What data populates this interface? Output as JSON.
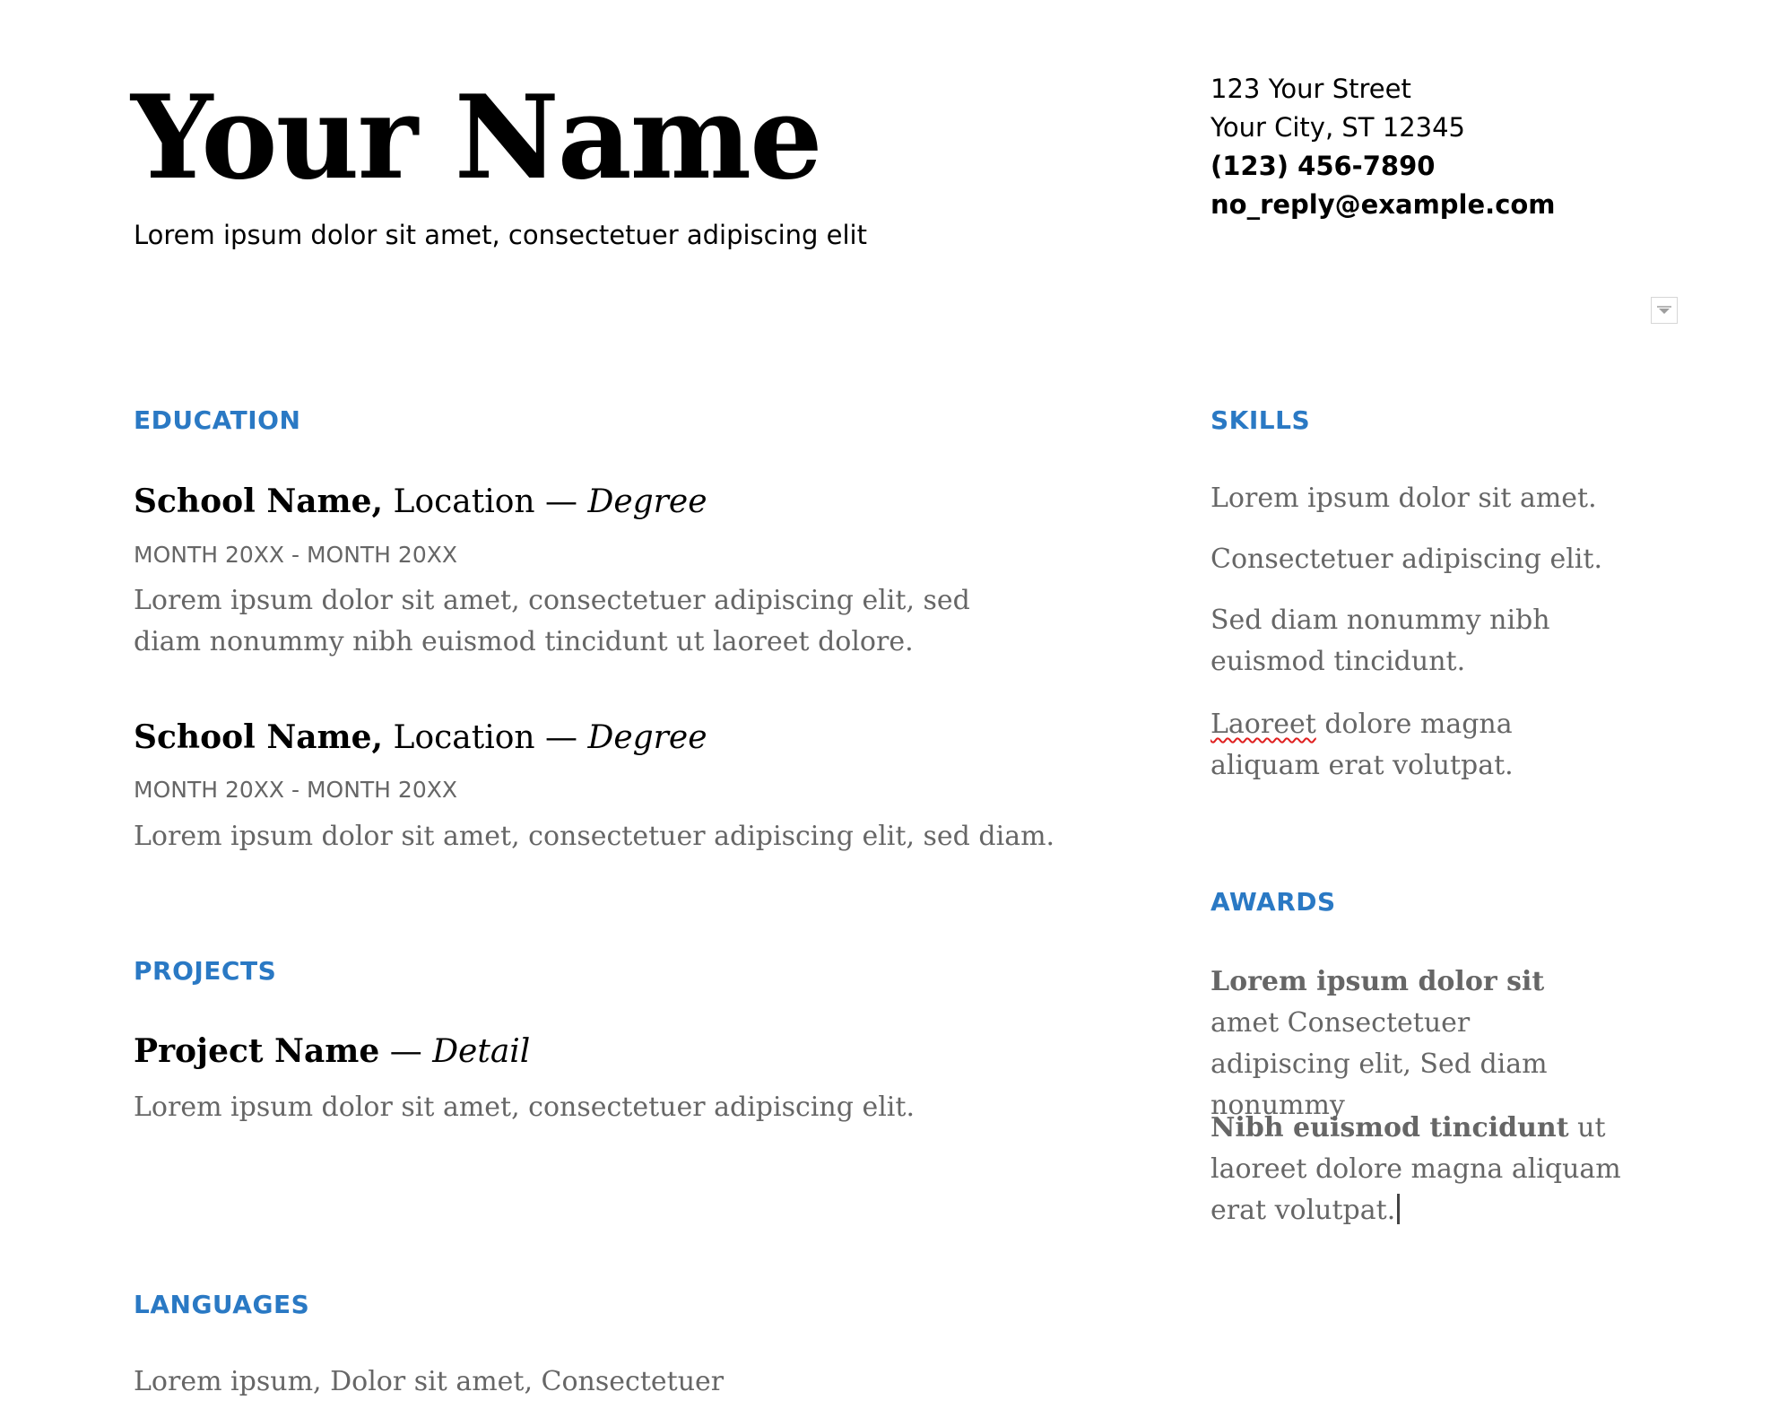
{
  "header": {
    "name": "Your Name",
    "tagline": "Lorem ipsum dolor sit amet, consectetuer adipiscing elit"
  },
  "contact": {
    "street": "123 Your Street",
    "city": "Your City, ST 12345",
    "phone": "(123) 456-7890",
    "email": "no_reply@example.com"
  },
  "colors": {
    "heading": "#2a79c4",
    "body_text": "#666666",
    "spellcheck": "#e02020"
  },
  "education": {
    "heading": "EDUCATION",
    "entries": [
      {
        "school": "School Name,",
        "location": " Location — ",
        "degree": "Degree",
        "dates": "MONTH 20XX - MONTH 20XX",
        "description": "Lorem ipsum dolor sit amet, consectetuer adipiscing elit, sed diam nonummy nibh euismod tincidunt ut laoreet dolore."
      },
      {
        "school": "School Name,",
        "location": " Location — ",
        "degree": "Degree",
        "dates": "MONTH 20XX - MONTH 20XX",
        "description": "Lorem ipsum dolor sit amet, consectetuer adipiscing elit, sed diam."
      }
    ]
  },
  "projects": {
    "heading": "PROJECTS",
    "entries": [
      {
        "name": "Project Name",
        "separator": " — ",
        "detail": "Detail",
        "description": "Lorem ipsum dolor sit amet, consectetuer adipiscing elit."
      }
    ]
  },
  "languages": {
    "heading": "LANGUAGES",
    "text": "Lorem ipsum, Dolor sit amet, Consectetuer"
  },
  "skills": {
    "heading": "SKILLS",
    "items": [
      "Lorem ipsum dolor sit amet.",
      "Consectetuer adipiscing elit.",
      "Sed diam nonummy nibh euismod tincidunt."
    ],
    "last_item_misspelled_word": "Laoreet",
    "last_item_rest": " dolore magna aliquam erat volutpat."
  },
  "awards": {
    "heading": "AWARDS",
    "items": [
      {
        "bold": "Lorem ipsum dolor sit",
        "rest": " amet Consectetuer adipiscing elit, Sed diam nonummy"
      },
      {
        "bold": "Nibh euismod tincidunt",
        "rest": " ut laoreet dolore magna aliquam erat volutpat."
      }
    ]
  },
  "controls": {
    "dropdown_icon": "chevron-down-icon"
  }
}
